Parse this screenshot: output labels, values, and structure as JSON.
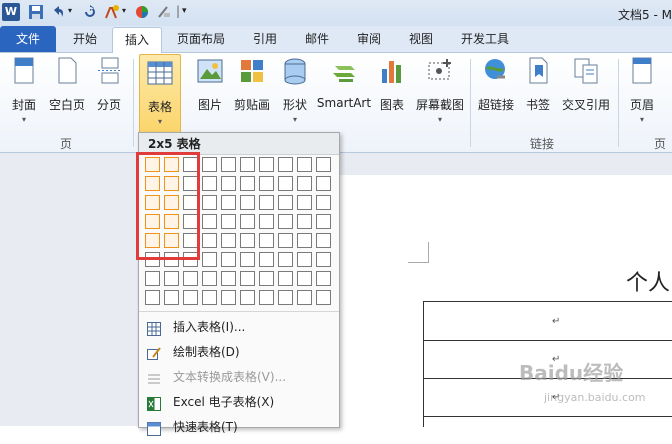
{
  "title_bar": {
    "app_icon": "W",
    "doc_title": "文档5 - M"
  },
  "tabs": [
    {
      "label": "文件"
    },
    {
      "label": "开始"
    },
    {
      "label": "插入"
    },
    {
      "label": "页面布局"
    },
    {
      "label": "引用"
    },
    {
      "label": "邮件"
    },
    {
      "label": "审阅"
    },
    {
      "label": "视图"
    },
    {
      "label": "开发工具"
    }
  ],
  "ribbon": {
    "buttons": [
      {
        "label": "封面"
      },
      {
        "label": "空白页"
      },
      {
        "label": "分页"
      },
      {
        "label": "表格"
      },
      {
        "label": "图片"
      },
      {
        "label": "剪贴画"
      },
      {
        "label": "形状"
      },
      {
        "label": "SmartArt"
      },
      {
        "label": "图表"
      },
      {
        "label": "屏幕截图"
      },
      {
        "label": "超链接"
      },
      {
        "label": "书签"
      },
      {
        "label": "交叉引用"
      },
      {
        "label": "页眉"
      }
    ],
    "groups": [
      {
        "label": "页"
      },
      {
        "label": "链接"
      },
      {
        "label": "页眉"
      }
    ]
  },
  "table_dropdown": {
    "header": "2x5 表格",
    "grid": {
      "cols": 10,
      "rows": 8,
      "selected_cols": 2,
      "selected_rows": 5
    },
    "menu": [
      {
        "label": "插入表格(I)...",
        "enabled": true,
        "icon": "insert-table-icon"
      },
      {
        "label": "绘制表格(D)",
        "enabled": true,
        "icon": "draw-table-icon"
      },
      {
        "label": "文本转换成表格(V)...",
        "enabled": false,
        "icon": "text-to-table-icon"
      },
      {
        "label": "Excel 电子表格(X)",
        "enabled": true,
        "icon": "excel-icon"
      },
      {
        "label": "快速表格(T)",
        "enabled": true,
        "icon": "quick-table-icon"
      }
    ]
  },
  "document": {
    "title_text": "个人",
    "para_mark": "↵",
    "watermark": "Baidu经验",
    "watermark_sub": "jingyan.baidu.com"
  },
  "colors": {
    "file_tab": "#2a66c0",
    "selection": "#f29318",
    "highlight_box": "#e03c3c"
  }
}
